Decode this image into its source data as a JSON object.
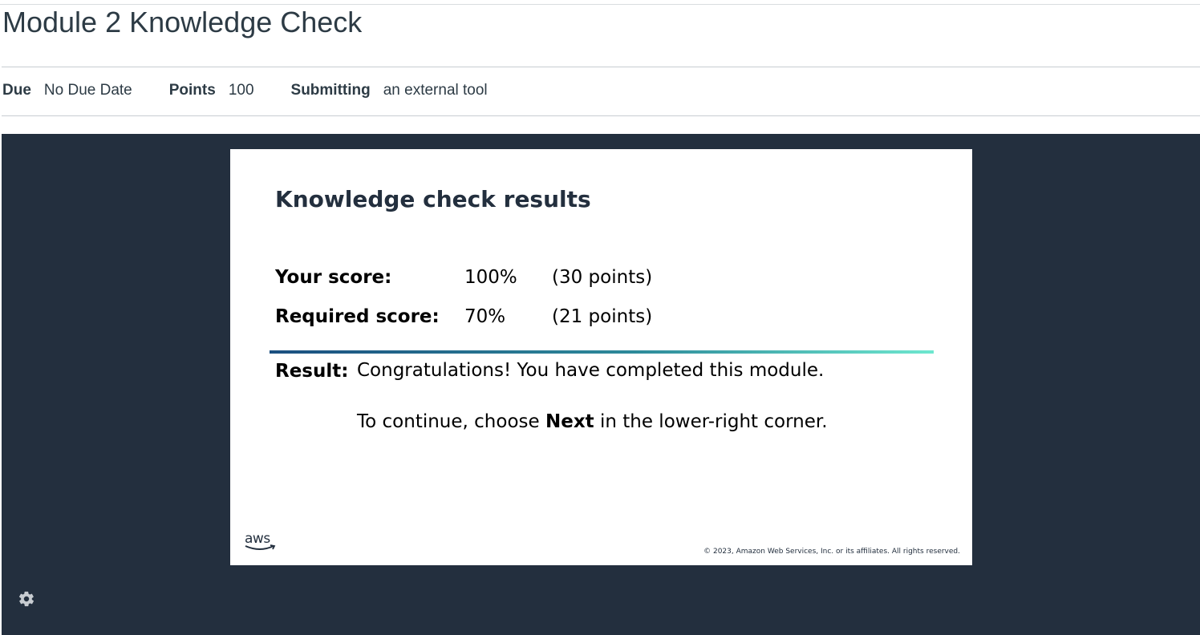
{
  "page": {
    "title": "Module 2 Knowledge Check"
  },
  "meta": {
    "due_label": "Due",
    "due_value": "No Due Date",
    "points_label": "Points",
    "points_value": "100",
    "submitting_label": "Submitting",
    "submitting_value": "an external tool"
  },
  "slide": {
    "title": "Knowledge check results",
    "your_score_label": "Your score:",
    "your_score_percent": "100%",
    "your_score_points": "(30 points)",
    "required_score_label": "Required score:",
    "required_score_percent": "70%",
    "required_score_points": "(21 points)",
    "result_label": "Result:",
    "result_message": "Congratulations! You have completed this module.",
    "continue_prefix": "To continue, choose ",
    "continue_bold": "Next",
    "continue_suffix": " in the lower-right corner.",
    "logo_text": "aws",
    "copyright": "© 2023, Amazon Web Services, Inc. or its affiliates. All rights reserved."
  },
  "icons": {
    "settings": "gear-icon",
    "logo": "aws-smile-icon"
  },
  "colors": {
    "frame_background": "#232f3e",
    "text_primary": "#2d3b45",
    "rule_start": "#1b4f80",
    "rule_end": "#6ee7cf",
    "gear": "#c7ccd1"
  }
}
